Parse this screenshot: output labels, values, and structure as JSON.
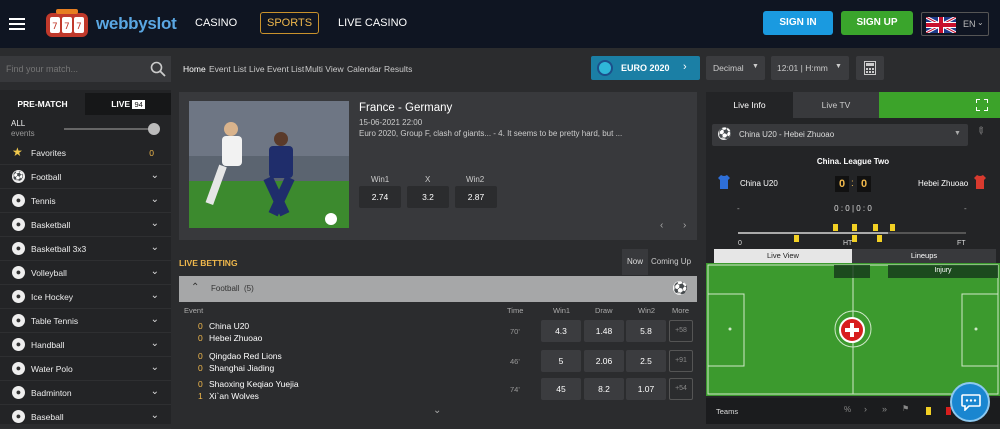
{
  "header": {
    "brand": "webbyslot",
    "nav": [
      "CASINO",
      "SPORTS",
      "LIVE CASINO"
    ],
    "sign_in": "SIGN IN",
    "sign_up": "SIGN UP",
    "lang": "EN"
  },
  "search": {
    "placeholder": "Find your match..."
  },
  "subnav": [
    "Home",
    "Event List",
    "Live Event List",
    "Multi View",
    "Calendar",
    "Results"
  ],
  "promo": "EURO 2020",
  "odds_format": "Decimal",
  "time_format": "12:01 | H:mm",
  "sidebar": {
    "tabs": {
      "prematch": "PRE-MATCH",
      "live": "LIVE",
      "live_count": "94"
    },
    "all": "ALL",
    "events": "events",
    "favorites": "Favorites",
    "favorites_count": "0",
    "items": [
      "Football",
      "Tennis",
      "Basketball",
      "Basketball 3x3",
      "Volleyball",
      "Ice Hockey",
      "Table Tennis",
      "Handball",
      "Water Polo",
      "Badminton",
      "Baseball"
    ]
  },
  "featured": {
    "title": "France - Germany",
    "datetime": "15-06-2021 22:00",
    "desc": "Euro 2020, Group F, clash of giants... - 4. It seems to be pretty hard, but ...",
    "labels": [
      "Win1",
      "X",
      "Win2"
    ],
    "odds": [
      "2.74",
      "3.2",
      "2.87"
    ]
  },
  "live_betting": {
    "title": "LIVE BETTING",
    "tab_now": "Now",
    "tab_coming": "Coming Up",
    "group": "Football",
    "group_count": "(5)",
    "cols": [
      "Event",
      "Time",
      "Win1",
      "Draw",
      "Win2",
      "More"
    ],
    "rows": [
      {
        "s1": "0",
        "t1": "China U20",
        "s2": "0",
        "t2": "Hebei Zhuoao",
        "time": "70'",
        "w1": "4.3",
        "d": "1.48",
        "w2": "5.8",
        "more": "+58"
      },
      {
        "s1": "0",
        "t1": "Qingdao Red Lions",
        "s2": "0",
        "t2": "Shanghai Jiading",
        "time": "46'",
        "w1": "5",
        "d": "2.06",
        "w2": "2.5",
        "more": "+91"
      },
      {
        "s1": "0",
        "t1": "Shaoxing Keqiao Yuejia",
        "s2": "1",
        "t2": "Xi`an Wolves",
        "time": "74'",
        "w1": "45",
        "d": "8.2",
        "w2": "1.07",
        "more": "+54"
      }
    ]
  },
  "right": {
    "tab_info": "Live Info",
    "tab_tv": "Live TV",
    "match_select": "China U20 - Hebei Zhuoao",
    "league": "China. League Two",
    "home": "China U20",
    "away": "Hebei Zhuoao",
    "score_home": "0",
    "score_away": "0",
    "half_score": "0 : 0 | 0 : 0",
    "dash_left": "-",
    "dash_right": "-",
    "tl_start": "0",
    "tl_ht": "HT",
    "tl_ft": "FT",
    "view_tab": "Live View",
    "lineups_tab": "Lineups",
    "injury": "Injury",
    "teams": "Teams"
  },
  "colors": {
    "signin": "#1a9ae0",
    "signup": "#3aa52c",
    "livegreen": "#3ca32a",
    "pitch": "#3c9a2e",
    "accent": "#f0b84c"
  }
}
